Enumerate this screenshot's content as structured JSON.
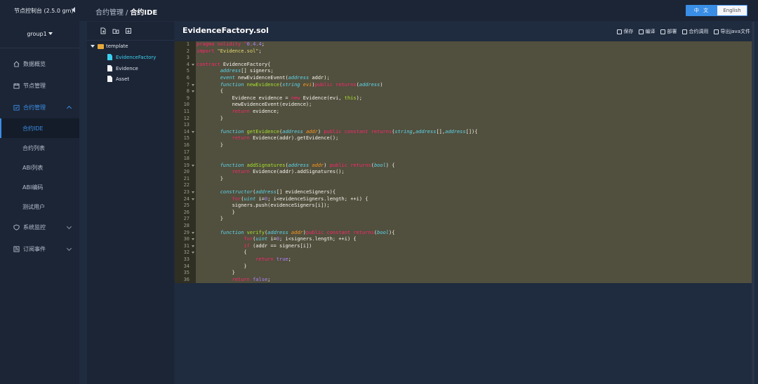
{
  "sidebar": {
    "app_title": "节点控制台 (2.5.0 gm)",
    "group": "group1",
    "menu": [
      {
        "label": "数据概览",
        "icon": "home-icon"
      },
      {
        "label": "节点管理",
        "icon": "calendar-icon"
      },
      {
        "label": "合约管理",
        "icon": "contract-icon"
      },
      {
        "label": "系统监控",
        "icon": "shield-icon"
      },
      {
        "label": "订阅事件",
        "icon": "rss-icon"
      }
    ],
    "submenu": [
      "合约IDE",
      "合约列表",
      "ABI列表",
      "ABI编码",
      "测试用户"
    ]
  },
  "header": {
    "breadcrumb_parent": "合约管理",
    "breadcrumb_sep": "/",
    "breadcrumb_current": "合约IDE",
    "lang_zh": "中 文",
    "lang_en": "English"
  },
  "tree": {
    "folder": "template",
    "files": [
      "EvidenceFactory",
      "Evidence",
      "Asset"
    ],
    "selected": "EvidenceFactory"
  },
  "editor": {
    "filename": "EvidenceFactory.sol",
    "actions": [
      "保存",
      "编译",
      "部署",
      "合约调用",
      "导出java文件"
    ]
  },
  "colors": {
    "accent": "#3a8ee6",
    "sidebar_bg": "#1c2536",
    "editor_bg": "#514f3d"
  }
}
